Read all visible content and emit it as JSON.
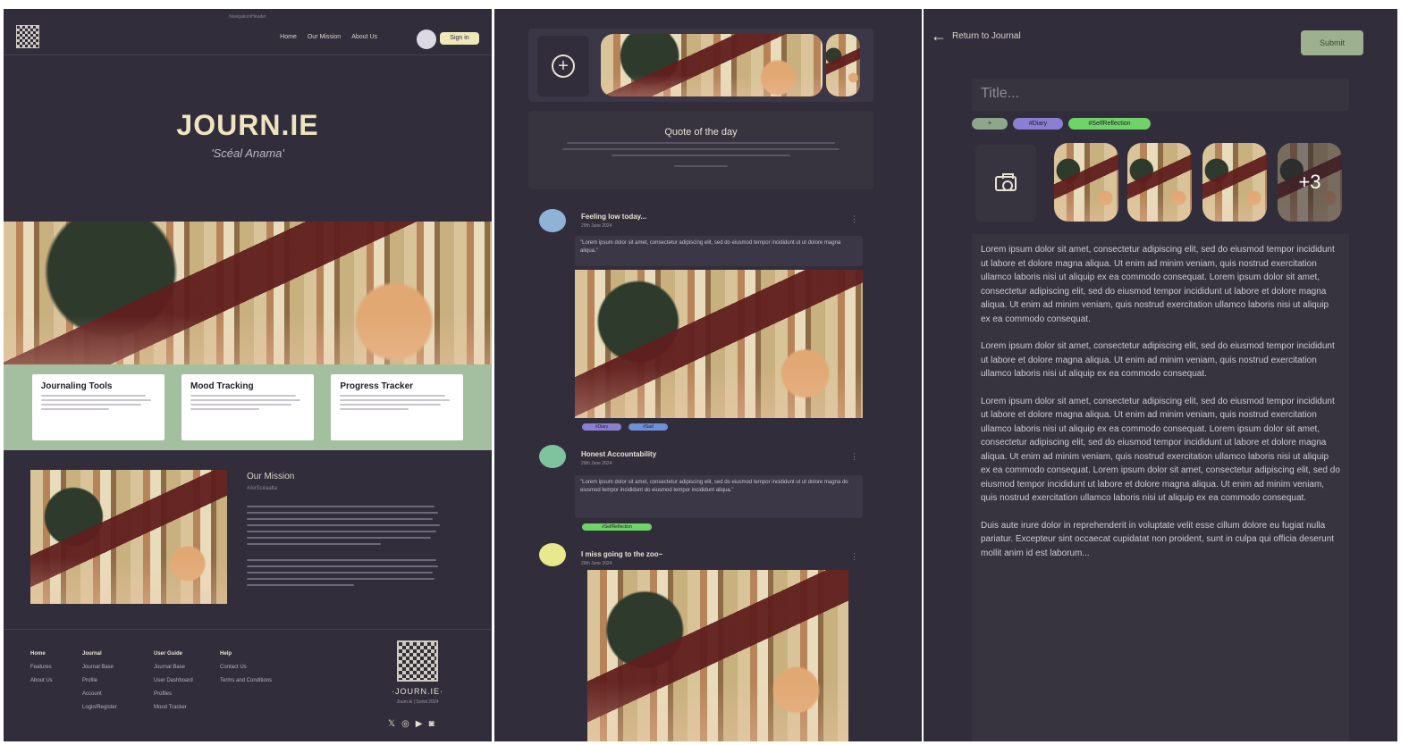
{
  "home": {
    "top_note": "Navigation/Header",
    "nav": [
      "Home",
      "Our Mission",
      "About Us"
    ],
    "sign_in": "Sign in",
    "title": "JOURN.IE",
    "subtitle": "'Scéal Anama'",
    "features": [
      {
        "title": "Journaling Tools"
      },
      {
        "title": "Mood Tracking"
      },
      {
        "title": "Progress Tracker"
      }
    ],
    "mission_title": "Our Mission",
    "mission_tag": "#AirScéaalta",
    "footer": {
      "cols": [
        {
          "heading": "Home",
          "items": [
            "Features",
            "About Us"
          ]
        },
        {
          "heading": "Journal",
          "items": [
            "Journal Base",
            "Profile",
            "Account",
            "Login/Register"
          ]
        },
        {
          "heading": "User Guide",
          "items": [
            "Journal Base",
            "User Dashboard",
            "Profiles",
            "Mood Tracker"
          ]
        },
        {
          "heading": "Help",
          "items": [
            "Contact Us",
            "Terms and Conditions"
          ]
        }
      ],
      "brand": "·JOURN.IE·",
      "copyright": "Journ.ie | Scéal 2024"
    }
  },
  "feed": {
    "quote_title": "Quote of the day",
    "posts": [
      {
        "title": "Feeling low today...",
        "date": "29th June 2024",
        "text": "\"Lorem ipsum dolor sit amet, consectetur adipiscing elit, sed do eiusmod tempor incididunt ut ut dolore magna aliqua.\"",
        "tags": [
          "#Diary",
          "#Sad"
        ],
        "color": "#8fb3d6"
      },
      {
        "title": "Honest Accountability",
        "date": "29th June 2024",
        "text": "\"Lorem ipsum dolor sit amet, consectetur adipiscing elit, sed do eiusmod tempor incididunt ut ut dolore magna do eiusmod tempor incididunt do eiusmod tempor incididunt aliqua.\"",
        "tags": [
          "#SelfReflection"
        ],
        "color": "#7fc29e"
      },
      {
        "title": "I miss going to the zoo~",
        "date": "29th June 2024",
        "color": "#e8e98c"
      }
    ]
  },
  "editor": {
    "back_label": "Return to Journal",
    "submit_label": "Submit",
    "title_placeholder": "Title...",
    "tags": [
      "+",
      "#Diary",
      "#SelfReflection"
    ],
    "more_count": "+3",
    "paragraphs": [
      "Lorem ipsum dolor sit amet, consectetur adipiscing elit, sed do eiusmod tempor incididunt ut labore et dolore magna aliqua. Ut enim ad minim veniam, quis nostrud exercitation ullamco laboris nisi ut aliquip ex ea commodo consequat. Lorem ipsum dolor sit amet, consectetur adipiscing elit, sed do eiusmod tempor incididunt ut labore et dolore magna aliqua. Ut enim ad minim veniam, quis nostrud exercitation ullamco laboris nisi ut aliquip ex ea commodo consequat.",
      "Lorem ipsum dolor sit amet, consectetur adipiscing elit, sed do eiusmod tempor incididunt ut labore et dolore magna aliqua. Ut enim ad minim veniam, quis nostrud exercitation ullamco laboris nisi ut aliquip ex ea commodo consequat.",
      "Lorem ipsum dolor sit amet, consectetur adipiscing elit, sed do eiusmod tempor incididunt ut labore et dolore magna aliqua. Ut enim ad minim veniam, quis nostrud exercitation ullamco laboris nisi ut aliquip ex ea commodo consequat. Lorem ipsum dolor sit amet, consectetur adipiscing elit, sed do eiusmod tempor incididunt ut labore et dolore magna aliqua. Ut enim ad minim veniam, quis nostrud exercitation ullamco laboris nisi ut aliquip ex ea commodo consequat. Lorem ipsum dolor sit amet, consectetur adipiscing elit, sed do eiusmod tempor incididunt ut labore et dolore magna aliqua. Ut enim ad minim veniam, quis nostrud exercitation ullamco laboris nisi ut aliquip ex ea commodo consequat.",
      "Duis aute irure dolor in reprehenderit in voluptate velit esse cillum dolore eu fugiat nulla pariatur. Excepteur sint occaecat cupidatat non proident, sunt in culpa qui officia deserunt mollit anim id est laborum..."
    ]
  },
  "colors": {
    "background": "#312d3b",
    "accent_green": "#a4bfa0",
    "cream": "#efe4c0",
    "tag_purple": "#8a7fd1",
    "tag_blue": "#6f8fd6",
    "tag_green": "#6fd36a"
  }
}
